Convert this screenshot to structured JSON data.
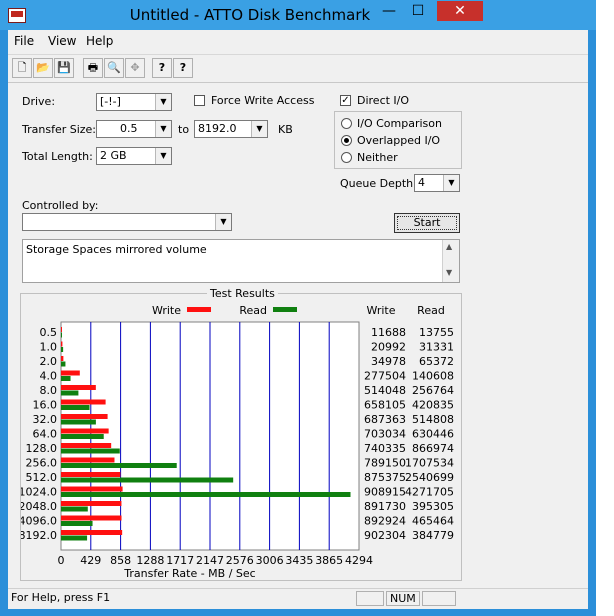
{
  "window": {
    "title": "Untitled - ATTO Disk Benchmark",
    "minimize_glyph": "—",
    "maximize_glyph": "☐",
    "close_glyph": "✕"
  },
  "menu": {
    "items": [
      "File",
      "View",
      "Help"
    ]
  },
  "toolbar": {
    "icons": [
      "new-document-icon",
      "open-folder-icon",
      "save-icon",
      "print-icon",
      "print-preview-icon",
      "move-icon",
      "help-icon",
      "context-help-icon"
    ],
    "glyphs": [
      "🗋",
      "📂",
      "💾",
      "🖶",
      "🔍",
      "✥",
      "?",
      "?"
    ]
  },
  "form": {
    "drive_label": "Drive:",
    "drive_value": "[-!-]",
    "force_write_label": "Force Write Access",
    "force_write_checked": false,
    "direct_io_label": "Direct I/O",
    "direct_io_checked": true,
    "transfer_size_label": "Transfer Size:",
    "transfer_from": "0.5",
    "to_label": "to",
    "transfer_to": "8192.0",
    "kb_label": "KB",
    "total_length_label": "Total Length:",
    "total_length_value": "2 GB",
    "io_options": [
      {
        "label": "I/O Comparison",
        "selected": false
      },
      {
        "label": "Overlapped I/O",
        "selected": true
      },
      {
        "label": "Neither",
        "selected": false
      }
    ],
    "queue_depth_label": "Queue Depth:",
    "queue_depth_value": "4",
    "controlled_by_label": "Controlled by:",
    "controlled_by_value": "",
    "start_label": "Start",
    "description": "Storage Spaces mirrored volume"
  },
  "results": {
    "title": "Test Results",
    "write_legend": "Write",
    "read_legend": "Read",
    "write_header": "Write",
    "read_header": "Read",
    "colors": {
      "write": "#ff1010",
      "read": "#108010"
    }
  },
  "chart_data": {
    "type": "bar",
    "title": "Test Results",
    "xlabel": "Transfer Rate - MB / Sec",
    "ylabel": "",
    "categories": [
      "0.5",
      "1.0",
      "2.0",
      "4.0",
      "8.0",
      "16.0",
      "32.0",
      "64.0",
      "128.0",
      "256.0",
      "512.0",
      "1024.0",
      "2048.0",
      "4096.0",
      "8192.0"
    ],
    "series": [
      {
        "name": "Write",
        "values": [
          11688,
          20992,
          34978,
          277504,
          514048,
          658105,
          687363,
          703034,
          740335,
          789150,
          875375,
          908915,
          891730,
          892924,
          902304
        ]
      },
      {
        "name": "Read",
        "values": [
          13755,
          31331,
          65372,
          140608,
          256764,
          420835,
          514808,
          630446,
          866974,
          1707534,
          2540699,
          4271705,
          395305,
          465464,
          384779
        ]
      }
    ],
    "xticks": [
      "0",
      "429",
      "858",
      "1288",
      "1717",
      "2147",
      "2576",
      "3006",
      "3435",
      "3865",
      "4294"
    ],
    "xlim": [
      0,
      4294
    ],
    "legend": "top"
  },
  "status": {
    "help_text": "For Help, press F1",
    "num_indicator": "NUM"
  }
}
